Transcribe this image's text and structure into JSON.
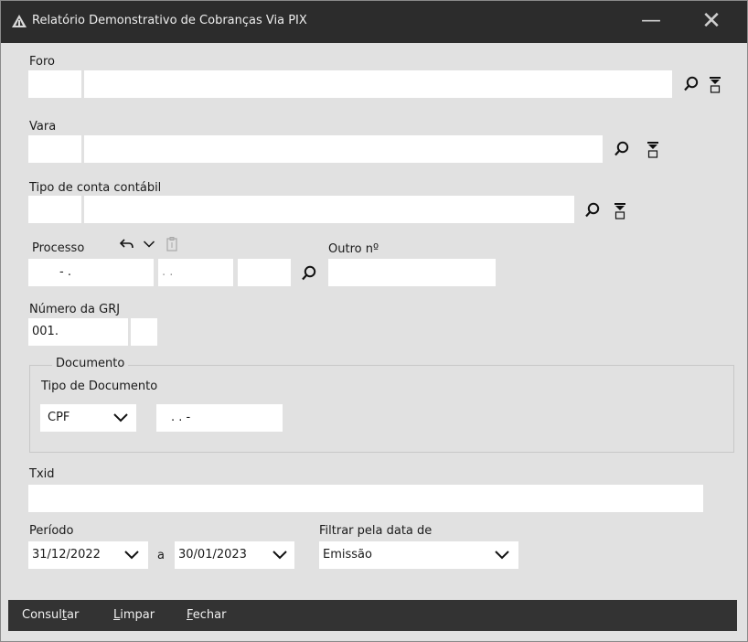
{
  "window": {
    "title": "Relatório Demonstrativo de Cobranças Via PIX",
    "minimize_glyph": "—",
    "close_glyph": "✕"
  },
  "foro": {
    "label": "Foro",
    "code": "",
    "name": ""
  },
  "vara": {
    "label": "Vara",
    "code": "",
    "name": ""
  },
  "tipo_conta": {
    "label": "Tipo de conta contábil",
    "code": "",
    "name": ""
  },
  "processo": {
    "label": "Processo",
    "part1": "- .",
    "part2": ". .",
    "part3": "",
    "outro_label": "Outro nº",
    "outro_value": ""
  },
  "grj": {
    "label": "Número da GRJ",
    "value": "001.",
    "digit": ""
  },
  "documento": {
    "group_label": "Documento",
    "tipo_label": "Tipo de Documento",
    "tipo_value": "CPF",
    "numero": ". . -"
  },
  "txid": {
    "label": "Txid",
    "value": ""
  },
  "periodo": {
    "label": "Período",
    "start": "31/12/2022",
    "separator": "a",
    "end": "30/01/2023"
  },
  "filtrar": {
    "label": "Filtrar pela data de",
    "value": "Emissão"
  },
  "actions": {
    "consultar_pre": "Consul",
    "consultar_key": "t",
    "consultar_post": "ar",
    "limpar_key": "L",
    "limpar_post": "impar",
    "fechar_key": "F",
    "fechar_post": "echar"
  },
  "icons": {
    "search": "magnifier-icon",
    "dropdown": "filter-dropdown-icon",
    "undo": "undo-icon",
    "chevron": "chevron-down-icon",
    "clipboard": "clipboard-icon",
    "app": "app-logo-icon"
  }
}
